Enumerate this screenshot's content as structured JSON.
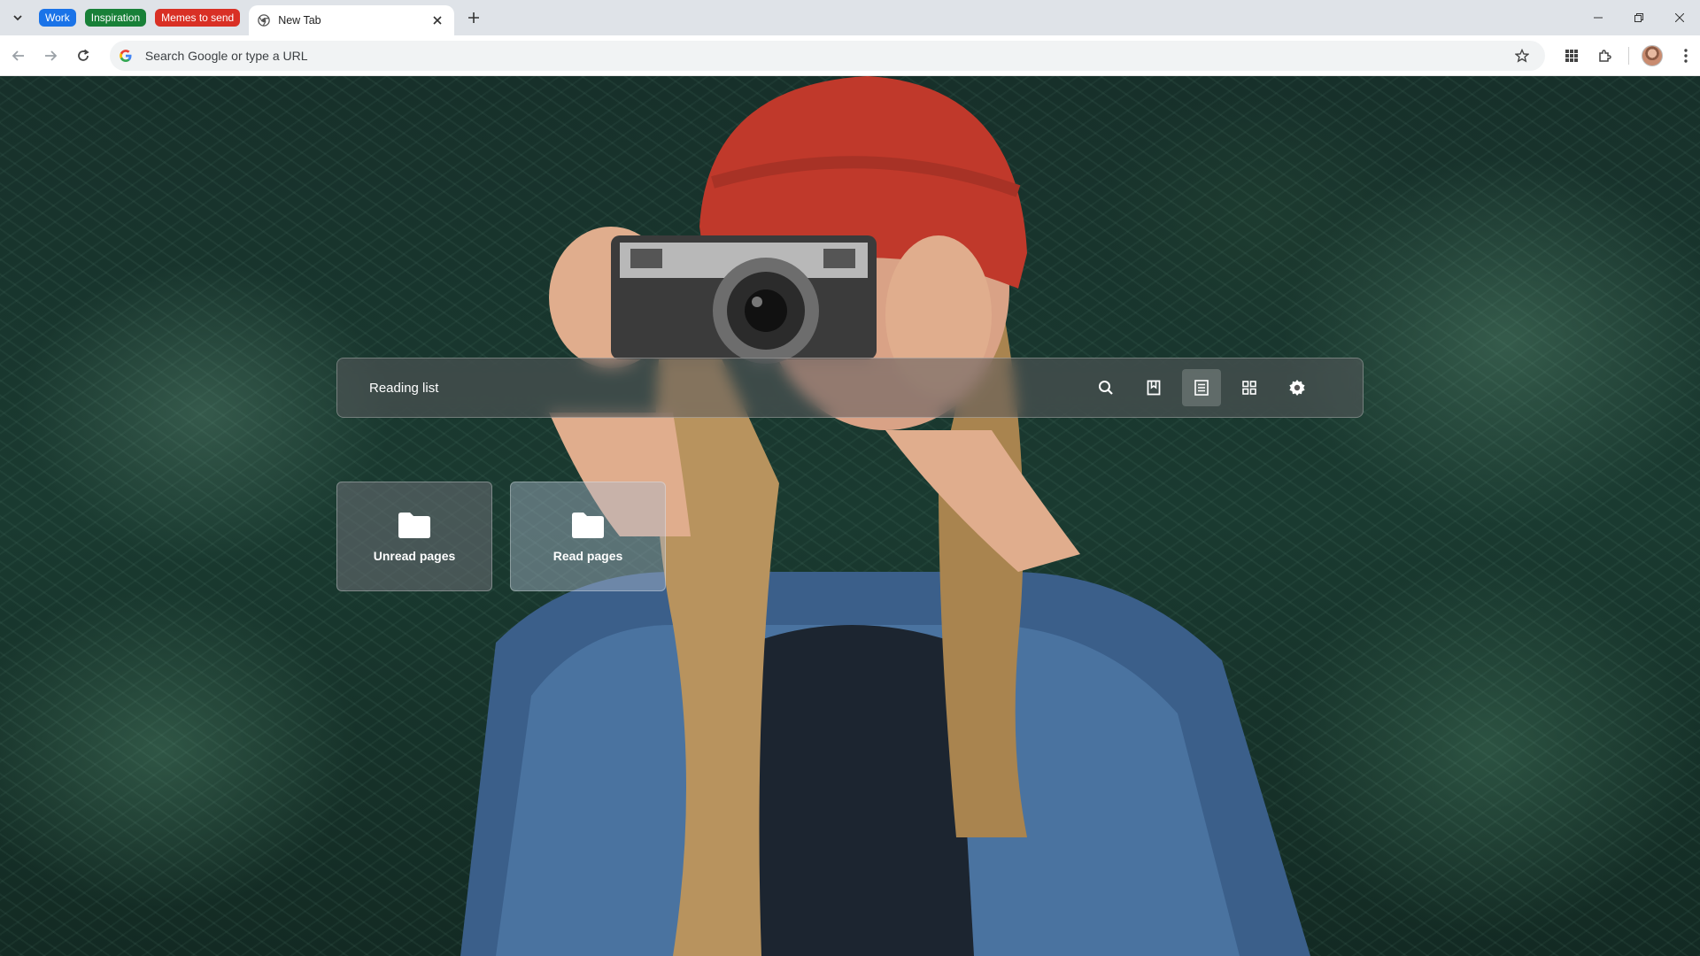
{
  "tab_groups": [
    {
      "label": "Work",
      "color": "#1a73e8"
    },
    {
      "label": "Inspiration",
      "color": "#188038"
    },
    {
      "label": "Memes to send",
      "color": "#d93025"
    }
  ],
  "active_tab": {
    "title": "New Tab",
    "icon": "chrome-icon"
  },
  "omnibox": {
    "placeholder": "Search Google or type a URL",
    "engine_icon": "google-g-icon"
  },
  "reading_list": {
    "title": "Reading list",
    "tools": [
      "search-icon",
      "bookmark-icon",
      "list-view-icon",
      "grid-view-icon",
      "gear-icon"
    ],
    "active_tool": "list-view-icon",
    "folders": [
      {
        "label": "Unread pages"
      },
      {
        "label": "Read pages"
      }
    ]
  }
}
